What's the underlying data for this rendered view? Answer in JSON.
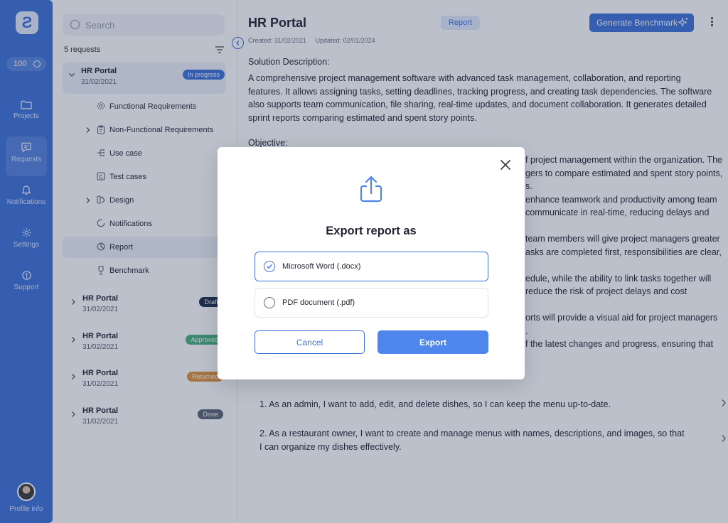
{
  "sidebar": {
    "logo_text": "Ƨ",
    "credits": "100",
    "nav": [
      {
        "label": "Projects",
        "icon": "folder-icon"
      },
      {
        "label": "Requests",
        "icon": "message-icon",
        "active": true
      },
      {
        "label": "Notifications",
        "icon": "bell-icon"
      },
      {
        "label": "Settings",
        "icon": "gear-icon"
      },
      {
        "label": "Support",
        "icon": "support-icon"
      }
    ],
    "profile_label": "Profile info"
  },
  "requests": {
    "search_placeholder": "Search",
    "count_label": "5 requests",
    "items": [
      {
        "title": "HR Portal",
        "date": "31/02/2021",
        "status": "In progress",
        "status_color": "#3f73d8"
      },
      {
        "title": "HR Portal",
        "date": "31/02/2021",
        "status": "Draft",
        "status_color": "#1f2d4d"
      },
      {
        "title": "HR Portal",
        "date": "31/02/2021",
        "status": "Approved",
        "status_color": "#49b27c"
      },
      {
        "title": "HR Portal",
        "date": "31/02/2021",
        "status": "Returned",
        "status_color": "#e3913a"
      },
      {
        "title": "HR Portal",
        "date": "31/02/2021",
        "status": "Done",
        "status_color": "#5e6677"
      }
    ],
    "subitems": [
      {
        "label": "Functional Requirements",
        "icon": "gear-small-icon"
      },
      {
        "label": "Non-Functional Requirements",
        "icon": "clipboard-icon"
      },
      {
        "label": "Use case",
        "icon": "flow-icon"
      },
      {
        "label": "Test cases",
        "icon": "checklist-icon"
      },
      {
        "label": "Design",
        "icon": "design-icon"
      },
      {
        "label": "Notifications",
        "icon": "bell-small-icon"
      },
      {
        "label": "Report",
        "icon": "report-icon"
      },
      {
        "label": "Benchmark",
        "icon": "trophy-icon"
      }
    ]
  },
  "header": {
    "title": "HR Portal",
    "tag": "Report",
    "generate_label": "Generate Benchmark",
    "created": "Created: 31/02/2021",
    "updated": "Updated: 02/01/2024"
  },
  "content": {
    "solution_heading": "Solution Description:",
    "solution_text": "A comprehensive project management software with advanced task management, collaboration, and reporting features. It allows assigning tasks, setting deadlines, tracking progress, and creating task dependencies. The software also supports team communication, file sharing, real-time updates, and document collaboration. It generates detailed sprint reports comparing estimated and spent story points.",
    "objective_heading": "Objective:",
    "objective_lines": [
      "f project management within the organization. The",
      "gers to compare estimated and spent story points,",
      "s.",
      "enhance teamwork and productivity among team",
      "communicate in real-time, reducing delays and",
      "team members will give project managers greater",
      "asks are completed first, responsibilities are clear,",
      "edule, while the ability to link tasks together will",
      "reduce the risk of project delays and cost",
      "orts will provide a visual aid for project managers",
      ".",
      "f the latest changes and progress, ensuring that"
    ],
    "stories": [
      "1. As an admin, I want to add, edit, and delete dishes, so I can keep the menu up-to-date.",
      "2. As a restaurant owner, I want to create and manage menus with names, descriptions, and images, so that I can organize my dishes effectively."
    ]
  },
  "modal": {
    "title": "Export report as",
    "options": [
      {
        "label": "Microsoft Word (.docx)",
        "selected": true
      },
      {
        "label": "PDF document (.pdf)",
        "selected": false
      }
    ],
    "cancel_label": "Cancel",
    "export_label": "Export"
  }
}
